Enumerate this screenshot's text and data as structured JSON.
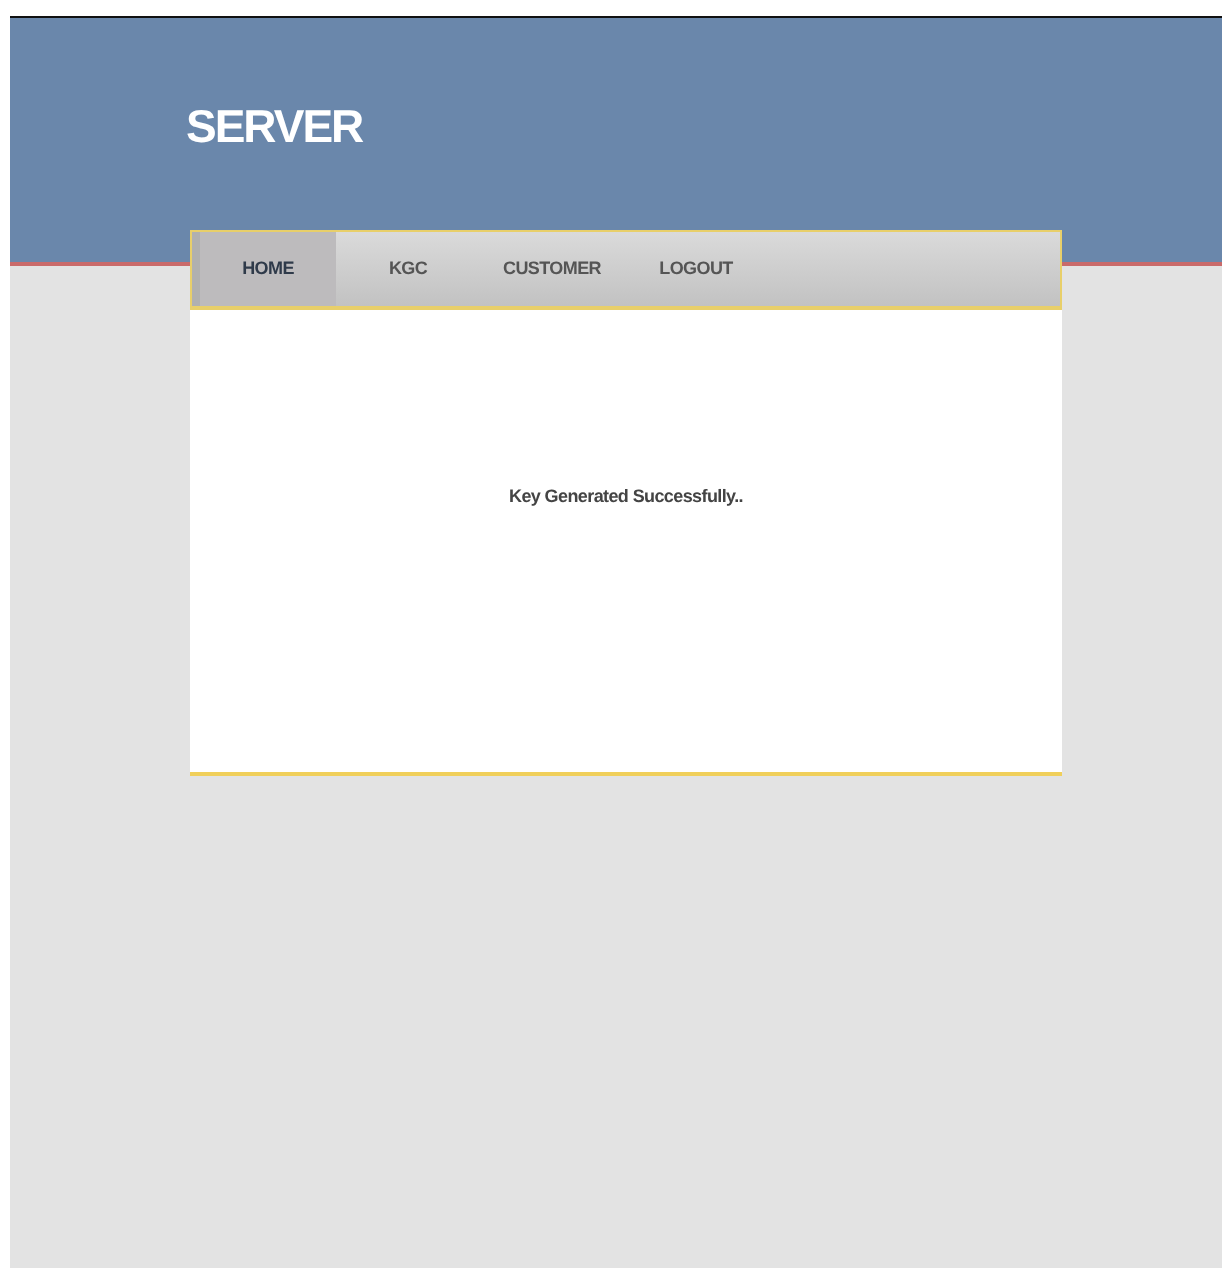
{
  "header": {
    "title": "SERVER"
  },
  "nav": [
    {
      "label": "HOME",
      "selected": true
    },
    {
      "label": "KGC",
      "selected": false
    },
    {
      "label": "CUSTOMER",
      "selected": false
    },
    {
      "label": "LOGOUT",
      "selected": false
    }
  ],
  "content": {
    "message": "Key Generated Successfully.."
  }
}
